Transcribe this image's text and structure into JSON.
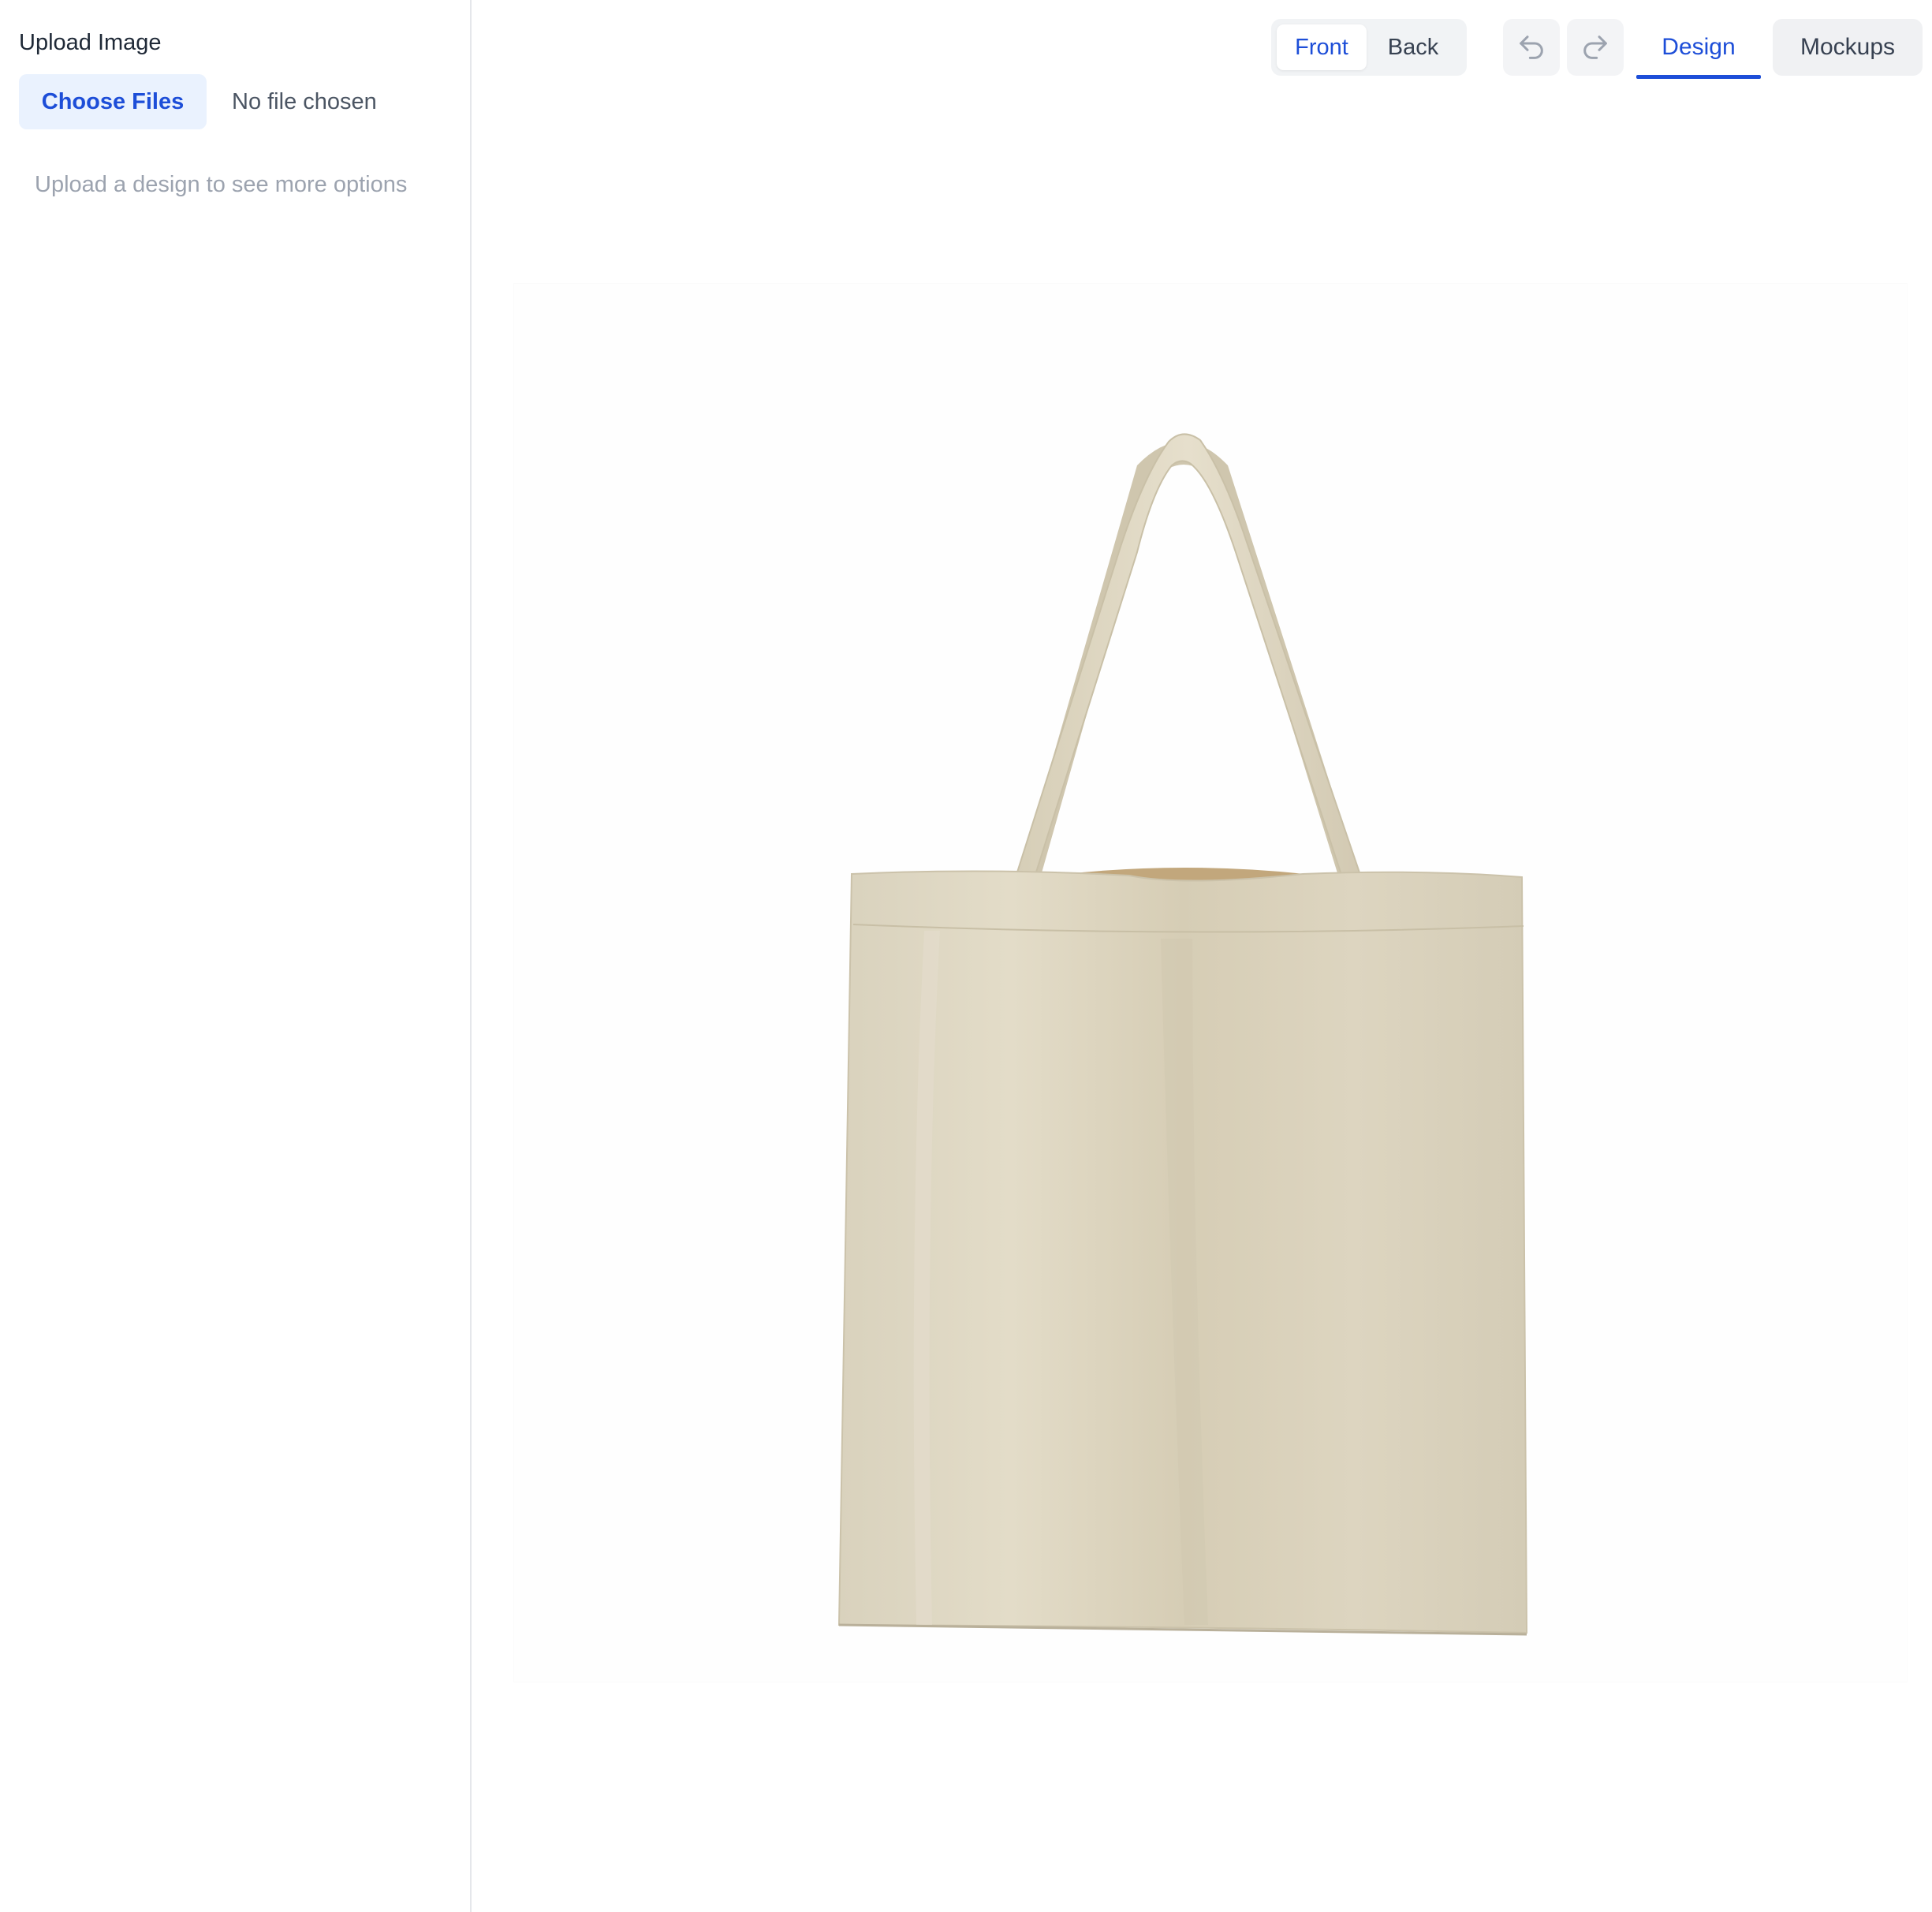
{
  "sidebar": {
    "upload_label": "Upload Image",
    "choose_files_label": "Choose Files",
    "no_file_text": "No file chosen",
    "hint_text": "Upload a design to see more options"
  },
  "toolbar": {
    "side_options": [
      "Front",
      "Back"
    ],
    "selected_side": "Front",
    "undo_icon": "undo-icon",
    "redo_icon": "redo-icon",
    "tabs": [
      "Design",
      "Mockups"
    ],
    "active_tab": "Design"
  },
  "canvas": {
    "product": "tote-bag",
    "product_color": "#ddd5c0"
  },
  "colors": {
    "accent": "#1d4ed8",
    "accent_bg": "#eaf2fe",
    "muted_text": "#9ca3af",
    "toolbar_bg": "#f1f3f5"
  }
}
